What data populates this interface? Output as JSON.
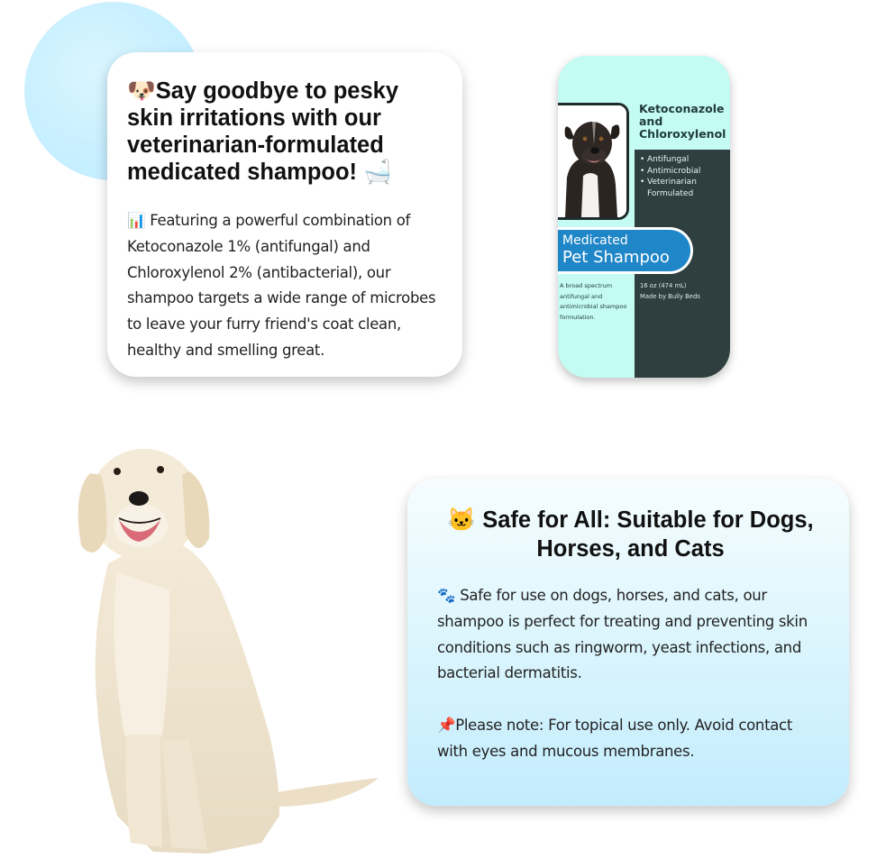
{
  "intro_card": {
    "title_icon": "dog-face-icon",
    "title": "🐶Say goodbye to pesky skin irritations with our veterinarian-formulated medicated shampoo! 🛁",
    "body": "📊 Featuring a powerful combination of Ketoconazole 1% (antifungal) and Chloroxylenol 2% (antibacterial), our shampoo targets a wide range of microbes to leave your furry friend's coat clean, healthy and smelling great."
  },
  "bottle": {
    "active_ingredients": "Ketoconazole\nand\nChloroxylenol",
    "bullets": [
      "Antifungal",
      "Antimicrobial",
      "Veterinarian Formulated"
    ],
    "label_line1": "Medicated",
    "label_line2": "Pet Shampoo",
    "description": "A broad spectrum antifungal and antimicrobial shampoo formulation.",
    "size_and_maker": "16 oz (474 mL)\nMade by Bully Beds",
    "colors": {
      "mint": "#c4fbf2",
      "dark": "#2f3e3e",
      "label_blue": "#1f86c8"
    }
  },
  "safety_card": {
    "title": "🐱 Safe for All: Suitable for Dogs, Horses, and Cats",
    "body": "🐾 Safe for use on dogs, horses, and cats, our shampoo is perfect for treating and preventing skin conditions such as ringworm, yeast infections, and bacterial dermatitis.",
    "note": "📌Please note: For topical use only. Avoid contact with eyes and mucous membranes."
  },
  "images": {
    "bottle_dog": "pit-bull-photo",
    "hero_dog": "golden-retriever-photo"
  }
}
